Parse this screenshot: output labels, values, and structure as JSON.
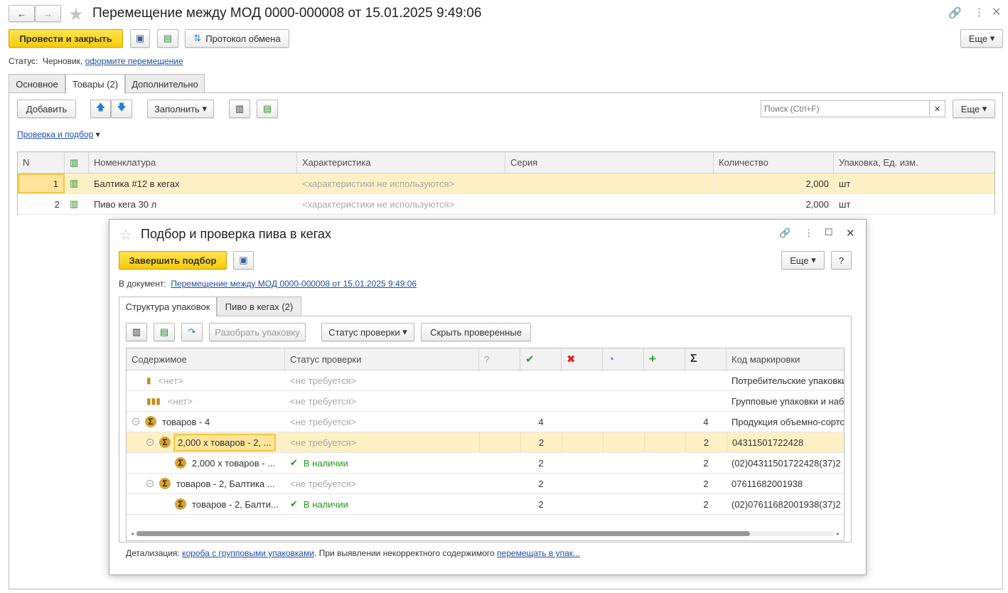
{
  "window": {
    "title": "Перемещение между МОД 0000-000008 от 15.01.2025 9:49:06"
  },
  "toolbar": {
    "post_close": "Провести и закрыть",
    "protocol": "Протокол обмена",
    "more": "Еще"
  },
  "status": {
    "label": "Статус:",
    "value": "Черновик,",
    "link": "оформите перемещение"
  },
  "tabs": [
    "Основное",
    "Товары (2)",
    "Дополнительно"
  ],
  "goods_toolbar": {
    "add": "Добавить",
    "fill": "Заполнить",
    "search_placeholder": "Поиск (Ctrl+F)",
    "more": "Еще",
    "check_link": "Проверка и подбор"
  },
  "goods_table": {
    "columns": [
      "N",
      "",
      "Номенклатура",
      "Характеристика",
      "Серия",
      "Количество",
      "Упаковка, Ед. изм."
    ],
    "rows": [
      {
        "n": "1",
        "name": "Балтика #12 в кегах",
        "char": "<характеристики не используются>",
        "series": "",
        "qty": "2,000",
        "unit": "шт"
      },
      {
        "n": "2",
        "name": "Пиво кега 30 л",
        "char": "<характеристики не используются>",
        "series": "",
        "qty": "2,000",
        "unit": "шт"
      }
    ]
  },
  "dialog": {
    "title": "Подбор и проверка пива в кегах",
    "finish": "Завершить подбор",
    "more": "Еще",
    "help": "?",
    "doc_label": "В документ:",
    "doc_link": "Перемещение между МОД 0000-000008 от 15.01.2025 9:49:06",
    "tabs": [
      "Структура упаковок",
      "Пиво в кегах (2)"
    ],
    "toolbar": {
      "unpack": "Разобрать упаковку",
      "check_status": "Статус проверки",
      "hide_checked": "Скрыть проверенные"
    },
    "columns": [
      "Содержимое",
      "Статус проверки",
      "?",
      "✔",
      "✖",
      "◔",
      "+",
      "Σ",
      "Код маркировки"
    ],
    "rows": [
      {
        "level": 0,
        "icon": "bottle-icon",
        "content": "<нет>",
        "status": "<не требуется>",
        "check": "",
        "total": "",
        "code": "Потребительские упаковки"
      },
      {
        "level": 0,
        "icon": "bottles-icon",
        "content": "<нет>",
        "status": "<не требуется>",
        "check": "",
        "total": "",
        "code": "Групповые упаковки и наб"
      },
      {
        "level": 0,
        "icon": "sigma-icon",
        "content": "товаров - 4",
        "status": "<не требуется>",
        "check": "4",
        "total": "4",
        "code": "Продукция объемно-сорто"
      },
      {
        "level": 1,
        "icon": "sigma-icon",
        "content": "2,000 х товаров - 2, ...",
        "status": "<не требуется>",
        "check": "2",
        "total": "2",
        "code": "04311501722428"
      },
      {
        "level": 2,
        "icon": "sigma-icon",
        "content": "2,000 х товаров - ...",
        "status": "В наличии",
        "check": "2",
        "total": "2",
        "code": "(02)04311501722428(37)2"
      },
      {
        "level": 1,
        "icon": "sigma-icon",
        "content": "товаров - 2, Балтика ...",
        "status": "<не требуется>",
        "check": "2",
        "total": "2",
        "code": "07611682001938"
      },
      {
        "level": 2,
        "icon": "sigma-icon",
        "content": "товаров - 2, Балти...",
        "status": "В наличии",
        "check": "2",
        "total": "2",
        "code": "(02)07611682001938(37)2"
      }
    ],
    "footer": {
      "label": "Детализация:",
      "link1": "короба с групповыми упаковками",
      "text": ". При выявлении некорректного содержимого",
      "link2": "перемещать в упак..."
    }
  },
  "colors": {
    "accent": "#f5cc0b",
    "selected_row": "#fdf0c4",
    "link": "#1c4fa8",
    "ok": "#1d9a1d"
  }
}
